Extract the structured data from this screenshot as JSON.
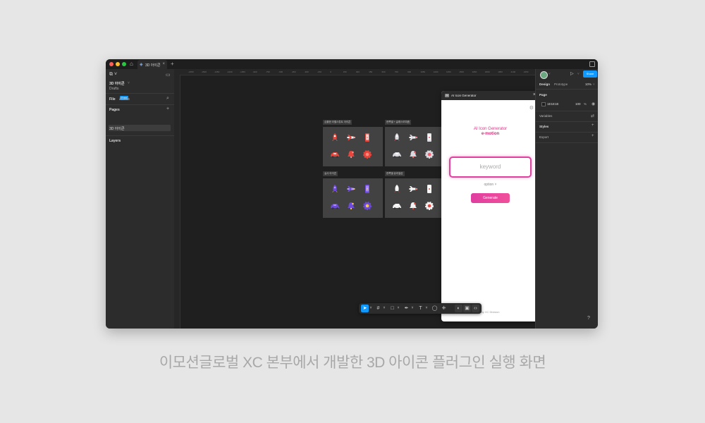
{
  "window": {
    "tab_title": "3D 아이콘",
    "tab_icon": "figma-icon",
    "traffic_colors": [
      "#ff5f57",
      "#febc2e",
      "#28c840"
    ]
  },
  "left_panel": {
    "file_name": "3D 아이콘",
    "drafts_label": "Drafts",
    "badge": "Free",
    "tab_file": "File",
    "tab_assets": "Assets",
    "pages_label": "Pages",
    "page_item": "3D 아이콘",
    "layers_label": "Layers"
  },
  "ruler_ticks": [
    "-1650",
    "-1500",
    "-1350",
    "-1200",
    "-1050",
    "-900",
    "-750",
    "-600",
    "-450",
    "-300",
    "-150",
    "0",
    "150",
    "300",
    "450",
    "600",
    "750",
    "900",
    "1050",
    "1200",
    "1350",
    "1500",
    "1650",
    "1800",
    "1950",
    "2100",
    "2250",
    "2400",
    "2550"
  ],
  "frames": [
    {
      "title": "심플한 라벨스튜트 아이콘",
      "style": "red"
    },
    {
      "title": "한쪽별 + 글래스모피즘",
      "style": "gray"
    },
    {
      "title": "실사 아이콘",
      "style": "purple"
    },
    {
      "title": "한쪽별 유리질감",
      "style": "white"
    }
  ],
  "icon_names": [
    "rocket-3d-icon",
    "airplane-3d-icon",
    "phone-3d-icon",
    "car-3d-icon",
    "bell-3d-icon",
    "gear-3d-icon"
  ],
  "plugin": {
    "title": "AI Icon Generator",
    "heading": "AI Icon Generator",
    "brand": "e-motion",
    "input_placeholder": "keyword",
    "option_label": "option",
    "generate_label": "Generate",
    "footer": "by XC Division"
  },
  "right_panel": {
    "share_label": "Share",
    "zoom": "10%",
    "tab_design": "Design",
    "tab_prototype": "Prototype",
    "page_label": "Page",
    "page_color": "1E1E1E",
    "page_opacity": "100",
    "percent": "%",
    "variables_label": "Variables",
    "styles_label": "Styles",
    "export_label": "Export",
    "help": "?"
  },
  "caption": "이모션글로벌 XC 본부에서 개발한 3D 아이콘 플러그인 실행 화면"
}
